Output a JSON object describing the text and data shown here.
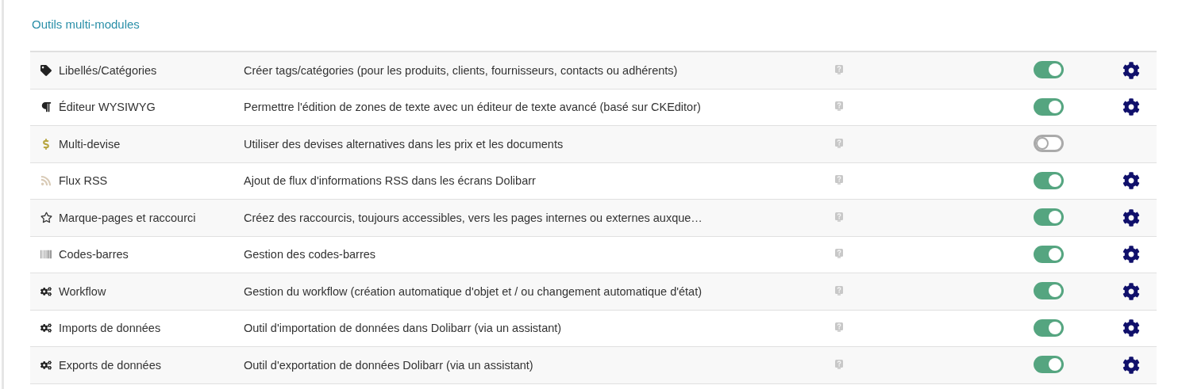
{
  "section_title": "Outils multi-modules",
  "modules": [
    {
      "kind": "tag",
      "name": "Libellés/Catégories",
      "description": "Créer tags/catégories (pour les produits, clients, fournisseurs, contacts ou adhérents)",
      "enabled": true,
      "configurable": true
    },
    {
      "kind": "paragraph",
      "name": "Éditeur WYSIWYG",
      "description": "Permettre l'édition de zones de texte avec un éditeur de texte avancé (basé sur CKEditor)",
      "enabled": true,
      "configurable": true
    },
    {
      "kind": "dollar",
      "name": "Multi-devise",
      "description": "Utiliser des devises alternatives dans les prix et les documents",
      "enabled": false,
      "configurable": false
    },
    {
      "kind": "rss",
      "name": "Flux RSS",
      "description": "Ajout de flux d'informations RSS dans les écrans Dolibarr",
      "enabled": true,
      "configurable": true
    },
    {
      "kind": "star",
      "name": "Marque-pages et raccourci",
      "description": "Créez des raccourcis, toujours accessibles, vers les pages internes ou externes auxque…",
      "enabled": true,
      "configurable": true
    },
    {
      "kind": "barcode",
      "name": "Codes-barres",
      "description": "Gestion des codes-barres",
      "enabled": true,
      "configurable": true
    },
    {
      "kind": "cogs",
      "name": "Workflow",
      "description": "Gestion du workflow (création automatique d'objet et / ou changement automatique d'état)",
      "enabled": true,
      "configurable": true
    },
    {
      "kind": "cogs",
      "name": "Imports de données",
      "description": "Outil d'importation de données dans Dolibarr (via un assistant)",
      "enabled": true,
      "configurable": true
    },
    {
      "kind": "cogs",
      "name": "Exports de données",
      "description": "Outil d'exportation de données Dolibarr (via un assistant)",
      "enabled": true,
      "configurable": true
    }
  ]
}
